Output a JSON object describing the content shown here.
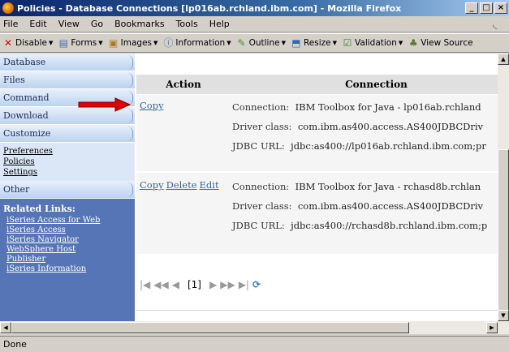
{
  "window": {
    "title": "Policies - Database Connections [lp016ab.rchland.ibm.com] - Mozilla Firefox",
    "min": "_",
    "max": "□",
    "close": "×"
  },
  "menu": [
    "File",
    "Edit",
    "View",
    "Go",
    "Bookmarks",
    "Tools",
    "Help"
  ],
  "toolbar": [
    {
      "label": "Disable",
      "icon": "disable-icon"
    },
    {
      "label": "Forms",
      "icon": "forms-icon"
    },
    {
      "label": "Images",
      "icon": "images-icon"
    },
    {
      "label": "Information",
      "icon": "information-icon"
    },
    {
      "label": "Outline",
      "icon": "outline-icon"
    },
    {
      "label": "Resize",
      "icon": "resize-icon"
    },
    {
      "label": "Validation",
      "icon": "validation-icon"
    },
    {
      "label": "View Source",
      "icon": "view-source-icon"
    }
  ],
  "nav": {
    "items": [
      "Database",
      "Files",
      "Command",
      "Download",
      "Customize"
    ],
    "sub": [
      "Preferences",
      "Policies",
      "Settings"
    ],
    "other": "Other",
    "related_title": "Related Links:",
    "related_links": [
      "iSeries Access for Web",
      "iSeries Access",
      "iSeries Navigator",
      "WebSphere Host",
      "Publisher",
      "iSeries Information"
    ]
  },
  "table": {
    "headers": {
      "action": "Action",
      "connection": "Connection"
    },
    "rows": [
      {
        "actions": [
          "Copy"
        ],
        "connection_label": "Connection:",
        "connection": "IBM Toolbox for Java - lp016ab.rchland",
        "driver_label": "Driver class:",
        "driver": "com.ibm.as400.access.AS400JDBCDriv",
        "url_label": "JDBC URL:",
        "url": "jdbc:as400://lp016ab.rchland.ibm.com;pr"
      },
      {
        "actions": [
          "Copy",
          "Delete",
          "Edit"
        ],
        "connection_label": "Connection:",
        "connection": "IBM Toolbox for Java - rchasd8b.rchlan",
        "driver_label": "Driver class:",
        "driver": "com.ibm.as400.access.AS400JDBCDriv",
        "url_label": "JDBC URL:",
        "url": "jdbc:as400://rchasd8b.rchland.ibm.com;p"
      }
    ]
  },
  "pager": {
    "page": "[1]"
  },
  "status": "Done",
  "colors": {
    "nav_bg": "#c5d9f1",
    "related_bg": "#5575b6",
    "link": "#336699",
    "arrow": "#e00000"
  }
}
